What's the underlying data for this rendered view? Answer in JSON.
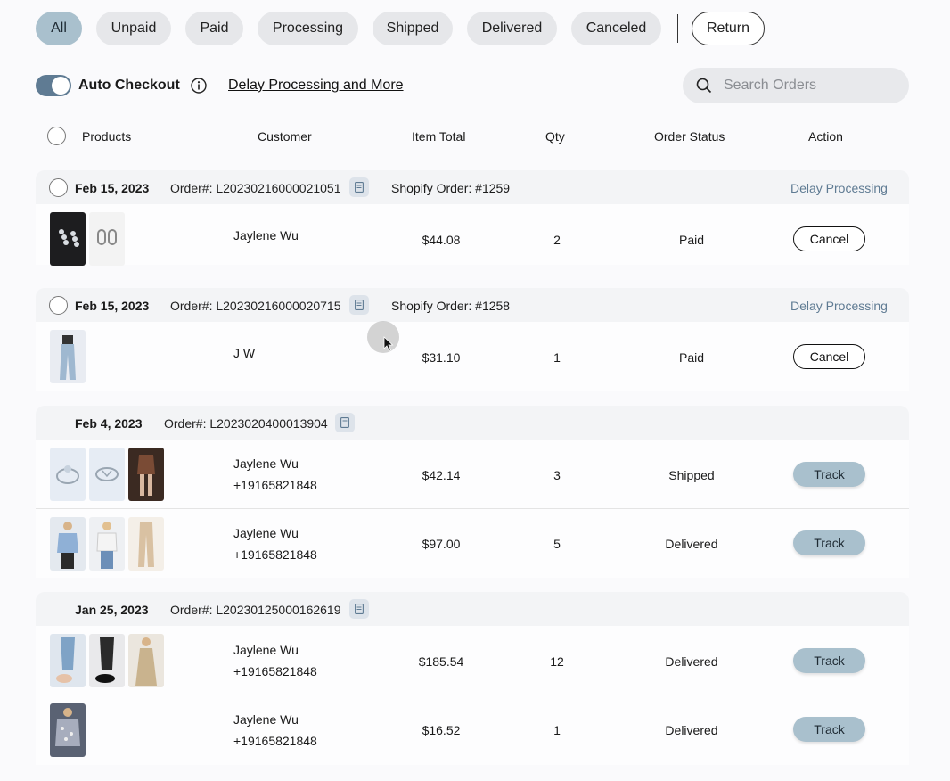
{
  "tabs": [
    {
      "label": "All",
      "active": true
    },
    {
      "label": "Unpaid"
    },
    {
      "label": "Paid"
    },
    {
      "label": "Processing"
    },
    {
      "label": "Shipped"
    },
    {
      "label": "Delivered"
    },
    {
      "label": "Canceled"
    }
  ],
  "return_label": "Return",
  "toolbar": {
    "auto_checkout_label": "Auto Checkout",
    "auto_checkout_on": true,
    "delay_link": "Delay Processing and More",
    "search_placeholder": "Search Orders"
  },
  "columns": [
    "Products",
    "Customer",
    "Item Total",
    "Qty",
    "Order Status",
    "Action"
  ],
  "orders": [
    {
      "date": "Feb 15, 2023",
      "order_no": "Order#: L20230216000021051",
      "shopify": "Shopify Order: #1259",
      "delay_action": "Delay Processing",
      "items": [
        {
          "customer": "Jaylene Wu",
          "phone": "",
          "total": "$44.08",
          "qty": "2",
          "status": "Paid",
          "action": "Cancel"
        }
      ]
    },
    {
      "date": "Feb 15, 2023",
      "order_no": "Order#: L20230216000020715",
      "shopify": "Shopify Order: #1258",
      "delay_action": "Delay Processing",
      "items": [
        {
          "customer": "J W",
          "phone": "",
          "total": "$31.10",
          "qty": "1",
          "status": "Paid",
          "action": "Cancel"
        }
      ]
    },
    {
      "date": "Feb 4, 2023",
      "order_no": "Order#: L2023020400013904",
      "items": [
        {
          "customer": "Jaylene Wu",
          "phone": "+19165821848",
          "total": "$42.14",
          "qty": "3",
          "status": "Shipped",
          "action": "Track"
        },
        {
          "customer": "Jaylene Wu",
          "phone": "+19165821848",
          "total": "$97.00",
          "qty": "5",
          "status": "Delivered",
          "action": "Track"
        }
      ]
    },
    {
      "date": "Jan 25, 2023",
      "order_no": "Order#: L20230125000162619",
      "items": [
        {
          "customer": "Jaylene Wu",
          "phone": "+19165821848",
          "total": "$185.54",
          "qty": "12",
          "status": "Delivered",
          "action": "Track"
        },
        {
          "customer": "Jaylene Wu",
          "phone": "+19165821848",
          "total": "$16.52",
          "qty": "1",
          "status": "Delivered",
          "action": "Track"
        }
      ]
    }
  ],
  "colors": {
    "accent": "#a9c0cd",
    "toggle": "#5f7b93",
    "link": "#5f7b93"
  },
  "icons": [
    "info-icon",
    "search-icon",
    "copy-icon",
    "mouse-cursor-icon"
  ]
}
